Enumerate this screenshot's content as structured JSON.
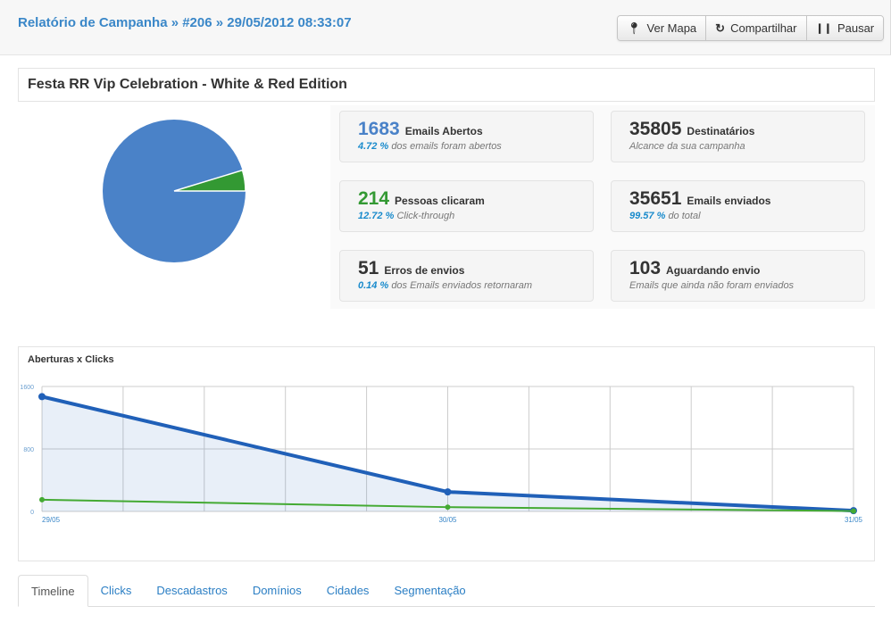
{
  "header": {
    "breadcrumb": "Relatório de Campanha » #206 » 29/05/2012 08:33:07",
    "buttons": [
      {
        "label": "Ver Mapa",
        "icon": "map-marker-icon"
      },
      {
        "label": "Compartilhar",
        "icon": "share-icon"
      },
      {
        "label": "Pausar",
        "icon": "pause-icon"
      }
    ]
  },
  "campaign": {
    "title": "Festa RR Vip Celebration - White & Red Edition"
  },
  "pie": {
    "colors": {
      "main": "#4a82c8",
      "clicks": "#339933"
    },
    "slice_fraction": 0.047
  },
  "stats": [
    {
      "value": "1683",
      "label": "Emails Abertos",
      "pct": "4.72 %",
      "sub": "dos emails foram abertos",
      "color": "#4a82c8"
    },
    {
      "value": "35805",
      "label": "Destinatários",
      "pct": "",
      "sub": "Alcance da sua campanha",
      "color": "#333333"
    },
    {
      "value": "214",
      "label": "Pessoas clicaram",
      "pct": "12.72 %",
      "sub": "Click-through",
      "color": "#339933"
    },
    {
      "value": "35651",
      "label": "Emails enviados",
      "pct": "99.57 %",
      "sub": "do total",
      "color": "#333333"
    },
    {
      "value": "51",
      "label": "Erros de envios",
      "pct": "0.14 %",
      "sub": "dos Emails enviados retornaram",
      "color": "#333333"
    },
    {
      "value": "103",
      "label": "Aguardando envio",
      "pct": "",
      "sub": "Emails que ainda não foram enviados",
      "color": "#333333"
    }
  ],
  "chart_data": {
    "type": "line",
    "title": "Aberturas x Clicks",
    "categories": [
      "29/05",
      "30/05",
      "31/05"
    ],
    "yticks": [
      "1600",
      "800",
      "0"
    ],
    "ylim": [
      0,
      1600
    ],
    "grid": true,
    "series": [
      {
        "values": [
          1470,
          250,
          10
        ],
        "color": "#2060b8",
        "area": true
      },
      {
        "values": [
          150,
          55,
          5
        ],
        "color": "#44aa33"
      }
    ]
  },
  "tabs": [
    "Timeline",
    "Clicks",
    "Descadastros",
    "Domínios",
    "Cidades",
    "Segmentação"
  ]
}
